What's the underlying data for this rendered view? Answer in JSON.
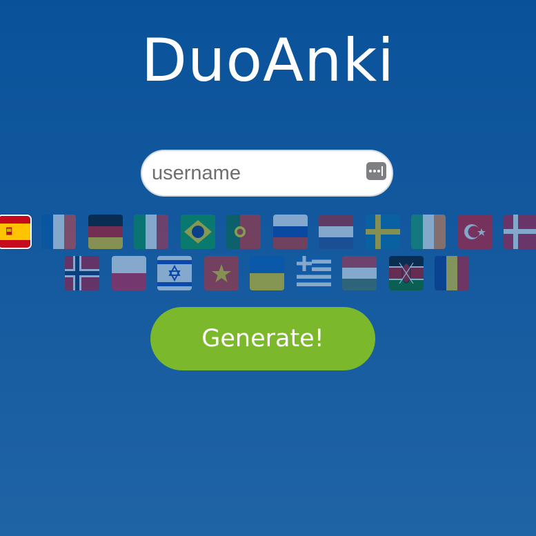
{
  "app": {
    "title": "DuoAnki"
  },
  "username": {
    "placeholder": "username",
    "value": ""
  },
  "password_manager_icon": "password-dots-icon",
  "languages": {
    "selected": "spanish",
    "row1": [
      "spanish",
      "french",
      "german",
      "italian",
      "portuguese-brazil",
      "portuguese",
      "russian",
      "dutch",
      "swedish",
      "irish",
      "turkish",
      "danish"
    ],
    "row2": [
      "norwegian",
      "polish",
      "hebrew",
      "vietnamese",
      "ukrainian",
      "greek",
      "hungarian",
      "swahili",
      "romanian"
    ]
  },
  "generate": {
    "label": "Generate!"
  },
  "colors": {
    "background": "#09529a",
    "button": "#7bb82c",
    "text": "#ffffff"
  }
}
